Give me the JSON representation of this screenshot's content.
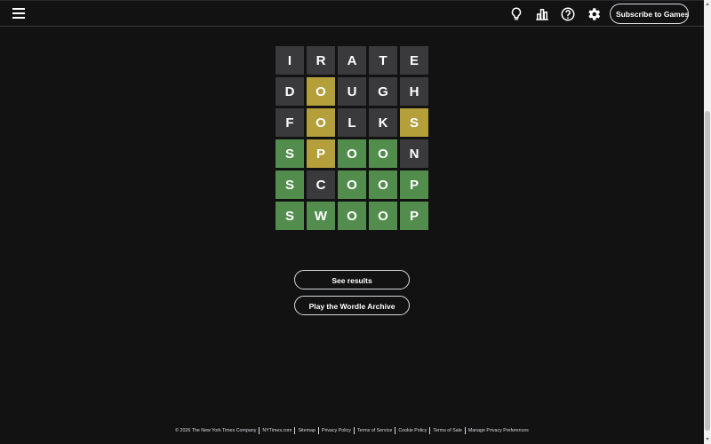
{
  "header": {
    "subscribe_label": "Subscribe to Games",
    "icons": [
      "menu-icon",
      "hint-lightbulb-icon",
      "stats-bar-chart-icon",
      "help-question-icon",
      "settings-gear-icon"
    ]
  },
  "board": {
    "rows": [
      [
        {
          "letter": "I",
          "state": "absent"
        },
        {
          "letter": "R",
          "state": "absent"
        },
        {
          "letter": "A",
          "state": "absent"
        },
        {
          "letter": "T",
          "state": "absent"
        },
        {
          "letter": "E",
          "state": "absent"
        }
      ],
      [
        {
          "letter": "D",
          "state": "absent"
        },
        {
          "letter": "O",
          "state": "present"
        },
        {
          "letter": "U",
          "state": "absent"
        },
        {
          "letter": "G",
          "state": "absent"
        },
        {
          "letter": "H",
          "state": "absent"
        }
      ],
      [
        {
          "letter": "F",
          "state": "absent"
        },
        {
          "letter": "O",
          "state": "present"
        },
        {
          "letter": "L",
          "state": "absent"
        },
        {
          "letter": "K",
          "state": "absent"
        },
        {
          "letter": "S",
          "state": "present"
        }
      ],
      [
        {
          "letter": "S",
          "state": "correct"
        },
        {
          "letter": "P",
          "state": "present"
        },
        {
          "letter": "O",
          "state": "correct"
        },
        {
          "letter": "O",
          "state": "correct"
        },
        {
          "letter": "N",
          "state": "absent"
        }
      ],
      [
        {
          "letter": "S",
          "state": "correct"
        },
        {
          "letter": "C",
          "state": "absent"
        },
        {
          "letter": "O",
          "state": "correct"
        },
        {
          "letter": "O",
          "state": "correct"
        },
        {
          "letter": "P",
          "state": "correct"
        }
      ],
      [
        {
          "letter": "S",
          "state": "correct"
        },
        {
          "letter": "W",
          "state": "correct"
        },
        {
          "letter": "O",
          "state": "correct"
        },
        {
          "letter": "O",
          "state": "correct"
        },
        {
          "letter": "P",
          "state": "correct"
        }
      ]
    ]
  },
  "actions": {
    "see_results": "See results",
    "archive": "Play the Wordle Archive"
  },
  "footer": {
    "copyright": "© 2026 The New York Times Company",
    "links": [
      "NYTimes.com",
      "Sitemap",
      "Privacy Policy",
      "Terms of Service",
      "Cookie Policy",
      "Terms of Sale",
      "Manage Privacy Preferences"
    ]
  },
  "colors": {
    "background": "#121213",
    "absent": "#3a3a3c",
    "present": "#b59f3b",
    "correct": "#538d4e"
  }
}
